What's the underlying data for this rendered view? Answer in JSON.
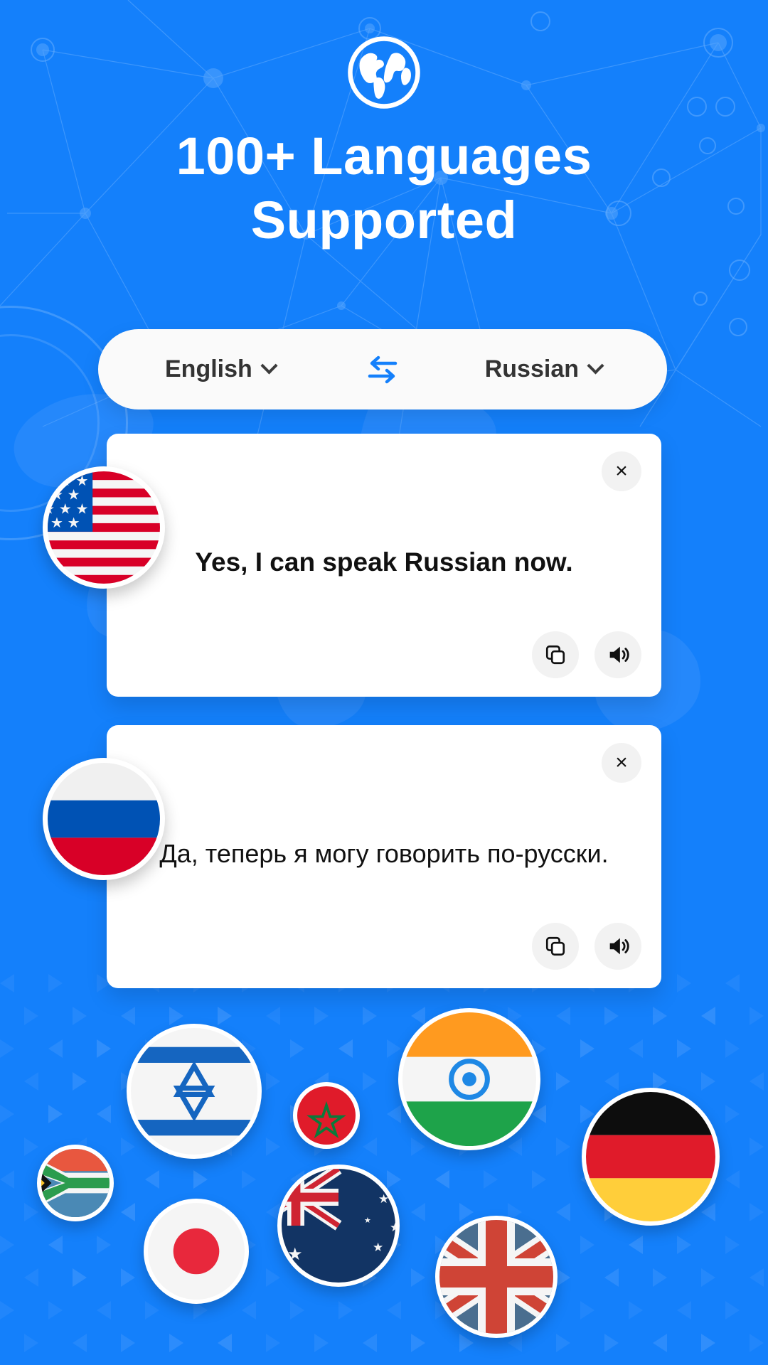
{
  "header": {
    "icon": "globe-icon",
    "title_line1": "100+ Languages",
    "title_line2": "Supported"
  },
  "language_selector": {
    "source_language": "English",
    "target_language": "Russian",
    "source_chevron": "chevron-down-icon",
    "target_chevron": "chevron-down-icon",
    "swap_icon": "swap-arrows-icon"
  },
  "cards": [
    {
      "id": "source",
      "flag": "us-flag-icon",
      "text": "Yes, I can speak Russian now.",
      "close_icon": "close-icon",
      "close_label": "×",
      "copy_icon": "copy-icon",
      "speaker_icon": "speaker-icon"
    },
    {
      "id": "target",
      "flag": "russia-flag-icon",
      "text": "Да, теперь я могу говорить по-русски.",
      "close_icon": "close-icon",
      "close_label": "×",
      "copy_icon": "copy-icon",
      "speaker_icon": "speaker-icon"
    }
  ],
  "flag_cloud": [
    {
      "name": "south-africa-flag-icon",
      "country": "South Africa"
    },
    {
      "name": "israel-flag-icon",
      "country": "Israel"
    },
    {
      "name": "morocco-flag-icon",
      "country": "Morocco"
    },
    {
      "name": "india-flag-icon",
      "country": "India"
    },
    {
      "name": "germany-flag-icon",
      "country": "Germany"
    },
    {
      "name": "japan-flag-icon",
      "country": "Japan"
    },
    {
      "name": "australia-flag-icon",
      "country": "Australia"
    },
    {
      "name": "united-kingdom-flag-icon",
      "country": "United Kingdom"
    }
  ],
  "colors": {
    "background_blue": "#1480FB",
    "card_white": "#FFFFFF",
    "selector_bg": "#FAFAFA",
    "accent_blue": "#1480FB",
    "icon_button_bg": "#F2F2F2",
    "text_dark": "#111111"
  }
}
